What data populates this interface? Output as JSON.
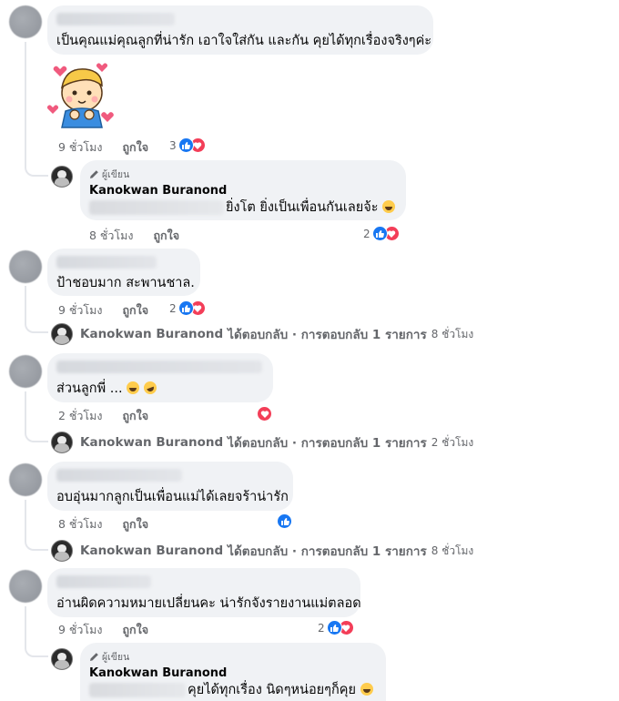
{
  "comments": [
    {
      "text": "เป็นคุณแม่คุณลูกที่น่ารัก เอาใจใส่กัน และกัน คุยได้ทุกเรื่องจริงๆค่ะ",
      "time": "9 ชั่วโมง",
      "like_label": "ถูกใจ",
      "reaction_count": "3",
      "reactions": [
        "like-icon",
        "love-icon"
      ]
    },
    {
      "text": "ป้าชอบมาก สะพานชาล.",
      "time": "9 ชั่วโมง",
      "like_label": "ถูกใจ",
      "reaction_count": "2",
      "reactions": [
        "like-icon",
        "love-icon"
      ]
    },
    {
      "text": "ส่วนลูกพี่ ...",
      "time": "2 ชั่วโมง",
      "like_label": "ถูกใจ",
      "reactions": [
        "love-icon"
      ]
    },
    {
      "text": "อบอุ่นมากลูกเป็นเพื่อนแม่ได้เลยจร้าน่ารัก",
      "time": "8 ชั่วโมง",
      "like_label": "ถูกใจ",
      "reactions": [
        "like-icon"
      ]
    },
    {
      "text": "อ่านผิดความหมายเปลี่ยนคะ น่ารักจังรายงานแม่ตลอด",
      "time": "9 ชั่วโมง",
      "like_label": "ถูกใจ",
      "reaction_count": "2",
      "reactions": [
        "like-icon",
        "love-icon"
      ]
    }
  ],
  "author_replies": [
    {
      "badge": "ผู้เขียน",
      "name": "Kanokwan Buranond",
      "text": "ยิ่งโต ยิ่งเป็นเพื่อนกันเลยจ้ะ",
      "time": "8 ชั่วโมง",
      "like_label": "ถูกใจ",
      "reaction_count": "2"
    },
    {
      "badge": "ผู้เขียน",
      "name": "Kanokwan Buranond",
      "text": "คุยได้ทุกเรื่อง นิดๆหน่อยๆก็คุย"
    }
  ],
  "collapsed_replies": [
    {
      "name": "Kanokwan Buranond",
      "action": "ได้ตอบกลับ · การตอบกลับ 1 รายการ",
      "time": "8 ชั่วโมง"
    },
    {
      "name": "Kanokwan Buranond",
      "action": "ได้ตอบกลับ · การตอบกลับ 1 รายการ",
      "time": "2 ชั่วโมง"
    },
    {
      "name": "Kanokwan Buranond",
      "action": "ได้ตอบกลับ · การตอบกลับ 1 รายการ",
      "time": "8 ชั่วโมง"
    }
  ],
  "colors": {
    "bubble": "#f0f2f5",
    "meta_text": "#65676b",
    "like_blue": "#1877f2",
    "love_red": "#f33e58"
  }
}
